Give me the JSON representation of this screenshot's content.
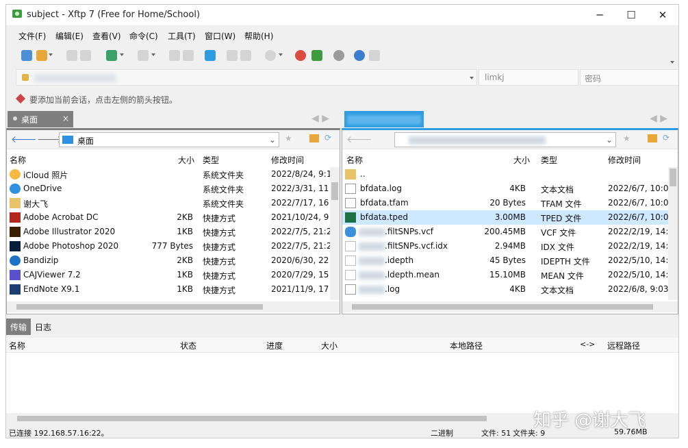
{
  "window": {
    "title": "subject - Xftp 7 (Free for Home/School)",
    "minimize": "─",
    "maximize": "☐",
    "close": "✕"
  },
  "menu": [
    "文件(F)",
    "编辑(E)",
    "查看(V)",
    "命令(C)",
    "工具(T)",
    "窗口(W)",
    "帮助(H)"
  ],
  "connection": {
    "username_placeholder": "limkj",
    "password_placeholder": "密码",
    "hint": "要添加当前会话，点击左侧的箭头按钮。"
  },
  "left_tab": {
    "label": "桌面",
    "close": "×"
  },
  "left_pane": {
    "path": "桌面",
    "columns": [
      "名称",
      "大小",
      "类型",
      "修改时间"
    ],
    "rows": [
      {
        "name": "iCloud 照片",
        "size": "",
        "type": "系统文件夹",
        "modified": "2022/8/24, 9:1"
      },
      {
        "name": "OneDrive",
        "size": "",
        "type": "系统文件夹",
        "modified": "2022/3/31, 11"
      },
      {
        "name": "谢大飞",
        "size": "",
        "type": "系统文件夹",
        "modified": "2022/7/17, 16"
      },
      {
        "name": "Adobe Acrobat DC",
        "size": "2KB",
        "type": "快捷方式",
        "modified": "2021/10/24, 9"
      },
      {
        "name": "Adobe Illustrator 2020",
        "size": "1KB",
        "type": "快捷方式",
        "modified": "2022/7/5, 21:2"
      },
      {
        "name": "Adobe Photoshop 2020",
        "size": "777 Bytes",
        "type": "快捷方式",
        "modified": "2022/7/5, 21:2"
      },
      {
        "name": "Bandizip",
        "size": "2KB",
        "type": "快捷方式",
        "modified": "2020/6/30, 22"
      },
      {
        "name": "CAJViewer 7.2",
        "size": "1KB",
        "type": "快捷方式",
        "modified": "2020/7/29, 15"
      },
      {
        "name": "EndNote X9.1",
        "size": "1KB",
        "type": "快捷方式",
        "modified": "2021/11/9, 17"
      }
    ]
  },
  "right_pane": {
    "columns": [
      "名称",
      "大小",
      "类型",
      "修改时间"
    ],
    "rows": [
      {
        "name": "..",
        "size": "",
        "type": "",
        "modified": ""
      },
      {
        "name": "bfdata.log",
        "size": "4KB",
        "type": "文本文档",
        "modified": "2022/6/7, 10:0"
      },
      {
        "name": "bfdata.tfam",
        "size": "20 Bytes",
        "type": "TFAM 文件",
        "modified": "2022/6/7, 10:0"
      },
      {
        "name": "bfdata.tped",
        "size": "3.00MB",
        "type": "TPED 文件",
        "modified": "2022/6/7, 10:0"
      },
      {
        "name": ".filtSNPs.vcf",
        "size": "200.45MB",
        "type": "VCF 文件",
        "modified": "2022/2/19, 14:5"
      },
      {
        "name": ".filtSNPs.vcf.idx",
        "size": "2.94MB",
        "type": "IDX 文件",
        "modified": "2022/2/19, 14:5"
      },
      {
        "name": ".idepth",
        "size": "45 Bytes",
        "type": "IDEPTH 文件",
        "modified": "2022/5/10, 14:5"
      },
      {
        "name": ".ldepth.mean",
        "size": "15.10MB",
        "type": "MEAN 文件",
        "modified": "2022/5/10, 14:5"
      },
      {
        "name": ".log",
        "size": "4KB",
        "type": "文本文档",
        "modified": "2022/6/8, 9:03"
      }
    ]
  },
  "bottom": {
    "tabs": [
      "传输",
      "日志"
    ],
    "columns": [
      "名称",
      "状态",
      "进度",
      "大小",
      "本地路径",
      "<->",
      "远程路径"
    ]
  },
  "status": {
    "connected": "已连接 192.168.57.16:22。",
    "mode": "二进制",
    "files": "文件: 51",
    "folders": "文件夹: 9",
    "total": "59.76MB"
  },
  "watermark": "知乎 @谢大飞",
  "colors": {
    "left_tab": "#7f7f7f",
    "right_tab": "#2f9be0",
    "selected_row": "#cde8ff"
  }
}
